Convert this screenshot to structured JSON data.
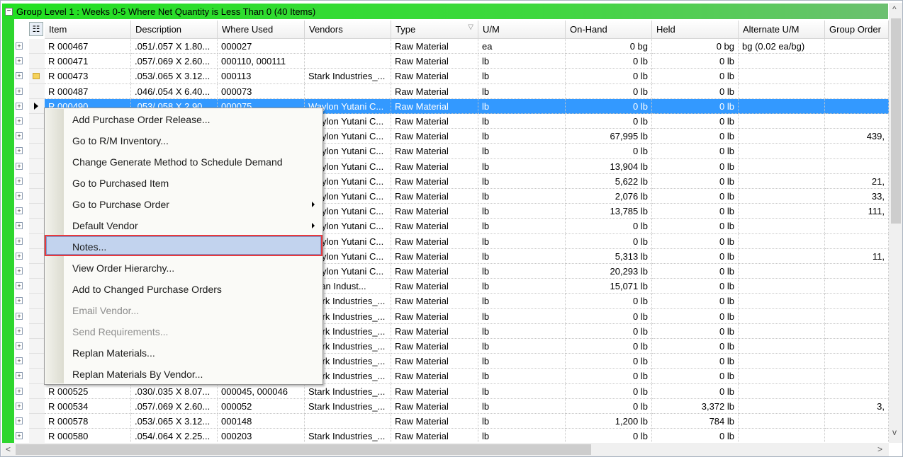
{
  "group": {
    "title": "Group Level 1 : Weeks 0-5 Where Net Quantity is Less Than 0 (40 Items)"
  },
  "columns": [
    "Item",
    "Description",
    "Where Used",
    "Vendors",
    "Type",
    "U/M",
    "On-Hand",
    "Held",
    "Alternate U/M",
    "Group Order"
  ],
  "rows": [
    [
      "R 000467",
      ".051/.057 X 1.80...",
      "000027",
      "",
      "Raw Material",
      "ea",
      "0 bg",
      "0 bg",
      "bg (0.02 ea/bg)",
      ""
    ],
    [
      "R 000471",
      ".057/.069 X 2.60...",
      "000110, 000111",
      "",
      "Raw Material",
      "lb",
      "0 lb",
      "0 lb",
      "",
      ""
    ],
    [
      "R 000473",
      ".053/.065 X 3.12...",
      "000113",
      "Stark Industries_...",
      "Raw Material",
      "lb",
      "0 lb",
      "0 lb",
      "",
      ""
    ],
    [
      "R 000487",
      ".046/.054 X 6.40...",
      "000073",
      "",
      "Raw Material",
      "lb",
      "0 lb",
      "0 lb",
      "",
      ""
    ],
    [
      "R 000490",
      ".053/.058 X 2.90...",
      "000075",
      "Waylon Yutani C...",
      "Raw Material",
      "lb",
      "0 lb",
      "0 lb",
      "",
      ""
    ],
    [
      "",
      "",
      "",
      "Waylon Yutani C...",
      "Raw Material",
      "lb",
      "0 lb",
      "0 lb",
      "",
      ""
    ],
    [
      "",
      "",
      "",
      "Waylon Yutani C...",
      "Raw Material",
      "lb",
      "67,995 lb",
      "0 lb",
      "",
      "439,"
    ],
    [
      "",
      "",
      "",
      "Waylon Yutani C...",
      "Raw Material",
      "lb",
      "0 lb",
      "0 lb",
      "",
      ""
    ],
    [
      "",
      "",
      "",
      "Waylon Yutani C...",
      "Raw Material",
      "lb",
      "13,904 lb",
      "0 lb",
      "",
      ""
    ],
    [
      "",
      "",
      "",
      "Waylon Yutani C...",
      "Raw Material",
      "lb",
      "5,622 lb",
      "0 lb",
      "",
      "21,"
    ],
    [
      "",
      "",
      "",
      "Waylon Yutani C...",
      "Raw Material",
      "lb",
      "2,076 lb",
      "0 lb",
      "",
      "33,"
    ],
    [
      "",
      "",
      "",
      "Waylon Yutani C...",
      "Raw Material",
      "lb",
      "13,785 lb",
      "0 lb",
      "",
      "111,"
    ],
    [
      "",
      "",
      "",
      "Waylon Yutani C...",
      "Raw Material",
      "lb",
      "0 lb",
      "0 lb",
      "",
      ""
    ],
    [
      "",
      "",
      "",
      "Waylon Yutani C...",
      "Raw Material",
      "lb",
      "0 lb",
      "0 lb",
      "",
      ""
    ],
    [
      "",
      "",
      "",
      "Waylon Yutani C...",
      "Raw Material",
      "lb",
      "5,313 lb",
      "0 lb",
      "",
      "11,"
    ],
    [
      "",
      "",
      "",
      "Waylon Yutani C...",
      "Raw Material",
      "lb",
      "20,293 lb",
      "0 lb",
      "",
      ""
    ],
    [
      "",
      "",
      "",
      "kman Indust...",
      "Raw Material",
      "lb",
      "15,071 lb",
      "0 lb",
      "",
      ""
    ],
    [
      "",
      "",
      "",
      "Stark Industries_...",
      "Raw Material",
      "lb",
      "0 lb",
      "0 lb",
      "",
      ""
    ],
    [
      "",
      "",
      "",
      "Stark Industries_...",
      "Raw Material",
      "lb",
      "0 lb",
      "0 lb",
      "",
      ""
    ],
    [
      "",
      "",
      "",
      "Stark Industries_...",
      "Raw Material",
      "lb",
      "0 lb",
      "0 lb",
      "",
      ""
    ],
    [
      "",
      "",
      "",
      "Stark Industries_...",
      "Raw Material",
      "lb",
      "0 lb",
      "0 lb",
      "",
      ""
    ],
    [
      "",
      "",
      "",
      "Stark Industries_...",
      "Raw Material",
      "lb",
      "0 lb",
      "0 lb",
      "",
      ""
    ],
    [
      "",
      "",
      "",
      "Stark Industries_...",
      "Raw Material",
      "lb",
      "0 lb",
      "0 lb",
      "",
      ""
    ],
    [
      "R 000525",
      ".030/.035 X 8.07...",
      "000045, 000046",
      "Stark Industries_...",
      "Raw Material",
      "lb",
      "0 lb",
      "0 lb",
      "",
      ""
    ],
    [
      "R 000534",
      ".057/.069 X 2.60...",
      "000052",
      "Stark Industries_...",
      "Raw Material",
      "lb",
      "0 lb",
      "3,372 lb",
      "",
      "3,"
    ],
    [
      "R 000578",
      ".053/.065 X 3.12...",
      "000148",
      "",
      "Raw Material",
      "lb",
      "1,200 lb",
      "784 lb",
      "",
      ""
    ],
    [
      "R 000580",
      ".054/.064 X 2.25...",
      "000203",
      "Stark Industries_...",
      "Raw Material",
      "lb",
      "0 lb",
      "0 lb",
      "",
      ""
    ]
  ],
  "selected_row": 4,
  "note_row": 2,
  "context_menu": [
    {
      "label": "Add Purchase Order Release...",
      "enabled": true
    },
    {
      "label": "Go to R/M Inventory...",
      "enabled": true
    },
    {
      "label": "Change Generate Method to Schedule Demand",
      "enabled": true
    },
    {
      "label": "Go to Purchased Item",
      "enabled": true
    },
    {
      "label": "Go to Purchase Order",
      "enabled": true,
      "submenu": true
    },
    {
      "label": "Default Vendor",
      "enabled": true,
      "submenu": true
    },
    {
      "label": "Notes...",
      "enabled": true,
      "highlighted": true
    },
    {
      "label": "View Order Hierarchy...",
      "enabled": true
    },
    {
      "label": "Add to Changed Purchase Orders",
      "enabled": true
    },
    {
      "label": "Email Vendor...",
      "enabled": false
    },
    {
      "label": "Send Requirements...",
      "enabled": false
    },
    {
      "label": "Replan Materials...",
      "enabled": true
    },
    {
      "label": "Replan Materials By Vendor...",
      "enabled": true
    }
  ],
  "colors": {
    "group_bar": "#22e022",
    "selection": "#3399ff",
    "highlight_border": "#e8393d"
  }
}
